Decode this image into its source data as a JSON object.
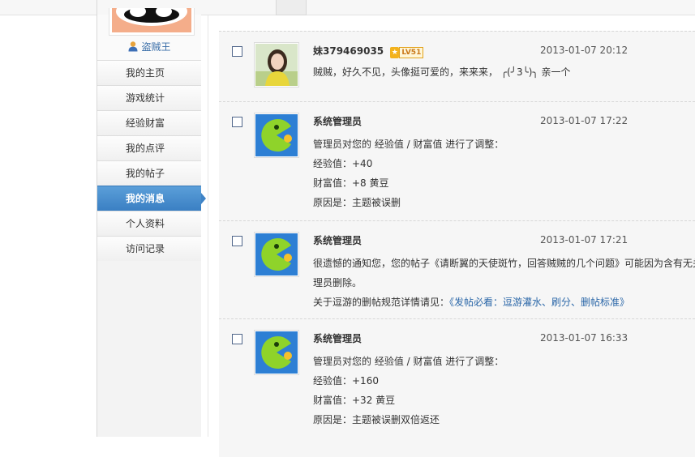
{
  "sidebar": {
    "username": "盗贼王",
    "items": [
      {
        "label": "我的主页"
      },
      {
        "label": "游戏统计"
      },
      {
        "label": "经验财富"
      },
      {
        "label": "我的点评"
      },
      {
        "label": "我的帖子"
      },
      {
        "label": "我的消息",
        "active": true
      },
      {
        "label": "个人资料"
      },
      {
        "label": "访问记录"
      }
    ]
  },
  "messages": [
    {
      "sender": "妹379469035",
      "level": "LV51",
      "time": "2013-01-07 20:12",
      "avatar": "girl-photo",
      "lines": [
        "贼贼，好久不见，头像挺可爱的，来来来， ╭(╯3╰)╮ 亲一个"
      ]
    },
    {
      "sender": "系统管理员",
      "time": "2013-01-07 17:22",
      "avatar": "pacman-icon",
      "lines": [
        "管理员对您的 经验值 / 财富值 进行了调整：",
        "经验值：+40",
        "财富值：+8 黄豆",
        "原因是：主题被误删"
      ]
    },
    {
      "sender": "系统管理员",
      "time": "2013-01-07 17:21",
      "avatar": "pacman-icon",
      "lines": [
        "很遗憾的通知您，您的帖子《请断翼的天使斑竹，回答贼贼的几个问题》可能因为含有无关",
        "理员删除。"
      ],
      "policy_prefix": "关于逗游的删帖规范详情请见：",
      "policy_link": "《发帖必看：逗游灌水、刷分、删帖标准》"
    },
    {
      "sender": "系统管理员",
      "time": "2013-01-07 16:33",
      "avatar": "pacman-icon",
      "lines": [
        "管理员对您的 经验值 / 财富值 进行了调整：",
        "经验值：+160",
        "财富值：+32 黄豆",
        "原因是：主题被误删双倍返还"
      ]
    }
  ],
  "colors": {
    "active_nav": "#4a8fd0",
    "link": "#2b67a8",
    "pacman": "#8fd32a",
    "pacman_bg": "#2d7fd4"
  }
}
